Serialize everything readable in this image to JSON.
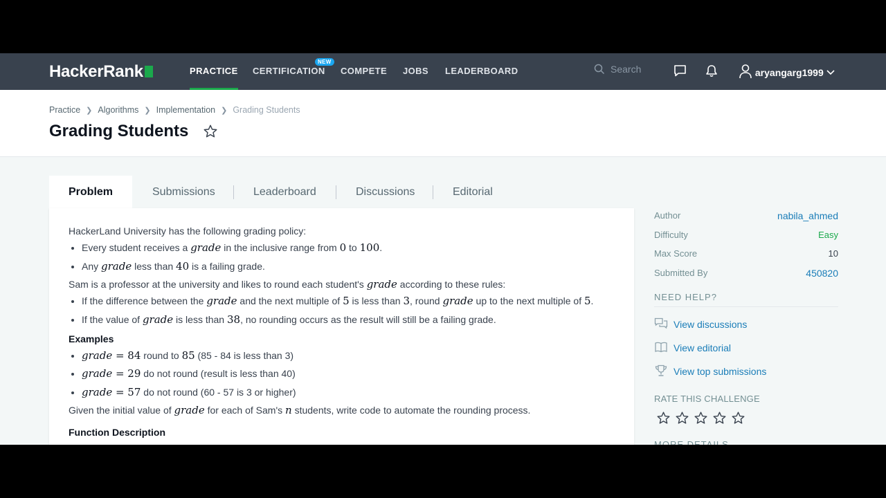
{
  "nav": {
    "logo": "HackerRank",
    "links": [
      "PRACTICE",
      "CERTIFICATION",
      "COMPETE",
      "JOBS",
      "LEADERBOARD"
    ],
    "new_badge": "NEW",
    "search_placeholder": "Search",
    "username": "aryangarg1999"
  },
  "breadcrumb": [
    "Practice",
    "Algorithms",
    "Implementation",
    "Grading Students"
  ],
  "title": "Grading Students",
  "tabs": [
    "Problem",
    "Submissions",
    "Leaderboard",
    "Discussions",
    "Editorial"
  ],
  "problem": {
    "intro": "HackerLand University has the following grading policy:",
    "policy": [
      {
        "t1": "Every student receives a ",
        "m1": "grade",
        "t2": " in the inclusive range from ",
        "n1": "0",
        "t3": " to ",
        "n2": "100",
        "t4": "."
      },
      {
        "t1": "Any ",
        "m1": "grade",
        "t2": " less than ",
        "n1": "40",
        "t3": " is a failing grade."
      }
    ],
    "rules_intro": {
      "t1": "Sam is a professor at the university and likes to round each student's ",
      "m1": "grade",
      "t2": " according to these rules:"
    },
    "rules": [
      {
        "t1": "If the difference between the ",
        "m1": "grade",
        "t2": " and the next multiple of ",
        "n1": "5",
        "t3": " is less than ",
        "n2": "3",
        "t4": ", round ",
        "m2": "grade",
        "t5": " up to the next multiple of ",
        "n3": "5",
        "t6": "."
      },
      {
        "t1": "If the value of ",
        "m1": "grade",
        "t2": " is less than ",
        "n1": "38",
        "t3": ", no rounding occurs as the result will still be a failing grade."
      }
    ],
    "examples_heading": "Examples",
    "examples": [
      {
        "expr": "grade",
        "val": " = 84",
        "text": " round to ",
        "n": "85",
        "note": " (85 - 84 is less than 3)"
      },
      {
        "expr": "grade",
        "val": " = 29",
        "text": " do not round (result is less than 40)",
        "n": "",
        "note": ""
      },
      {
        "expr": "grade",
        "val": " = 57",
        "text": " do not round (60 - 57 is 3 or higher)",
        "n": "",
        "note": ""
      }
    ],
    "closing": {
      "t1": "Given the initial value of ",
      "m1": "grade",
      "t2": " for each of Sam's ",
      "m2": "n",
      "t3": " students, write code to automate the rounding process."
    },
    "next_heading": "Function Description"
  },
  "sidebar": {
    "details": [
      {
        "key": "Author",
        "value": "nabila_ahmed"
      },
      {
        "key": "Difficulty",
        "value": "Easy"
      },
      {
        "key": "Max Score",
        "value": "10"
      },
      {
        "key": "Submitted By",
        "value": "450820"
      }
    ],
    "need_help": "NEED HELP?",
    "help_links": [
      "View discussions",
      "View editorial",
      "View top submissions"
    ],
    "rate": "RATE THIS CHALLENGE",
    "more": "MORE DETAILS"
  },
  "colors": {
    "nav_bg": "#39424e",
    "accent_green": "#1ba94c",
    "link_blue": "#1a7db8",
    "badge_blue": "#1aa6f0"
  }
}
